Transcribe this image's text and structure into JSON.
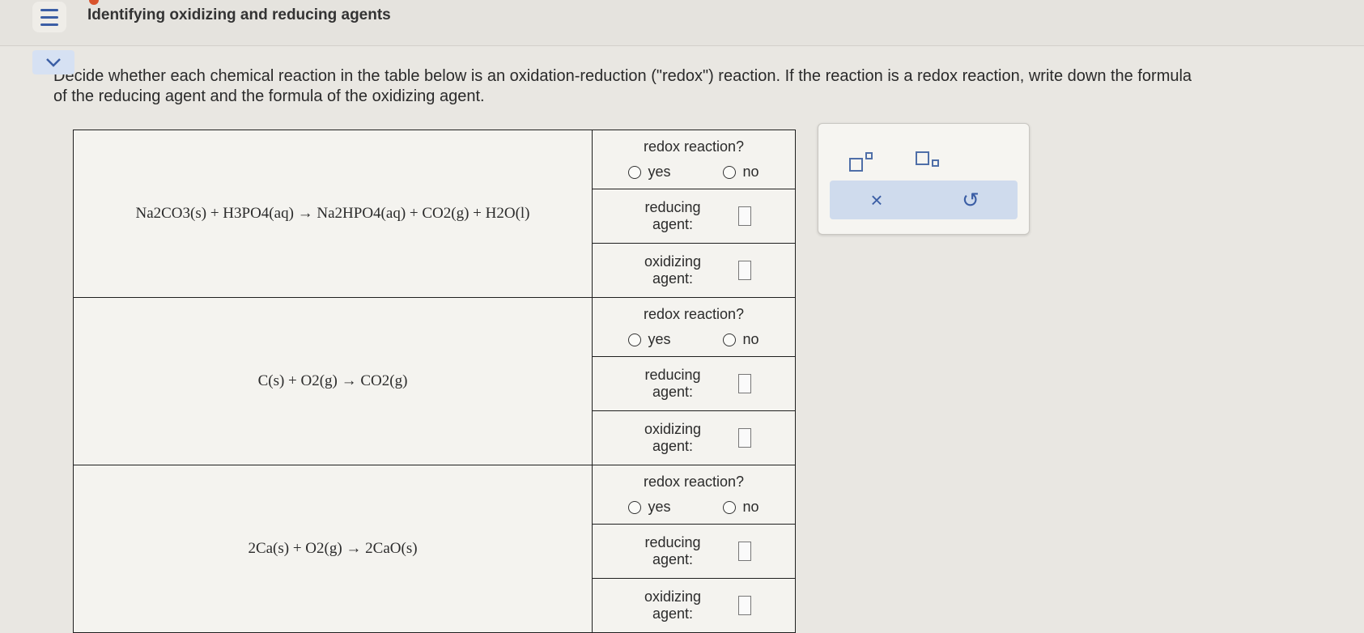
{
  "header": {
    "title": "Identifying oxidizing and reducing agents"
  },
  "instructions": {
    "line1": "Decide whether each chemical reaction in the table below is an oxidation-reduction (\"redox\") reaction. If the reaction is a redox reaction, write down the formula",
    "line2": "of the reducing agent and the formula of the oxidizing agent."
  },
  "labels": {
    "redox_question": "redox reaction?",
    "yes": "yes",
    "no": "no",
    "reducing_agent": "reducing agent:",
    "oxidizing_agent": "oxidizing agent:"
  },
  "reactions": [
    {
      "equation": "Na2CO3(s) + H3PO4(aq) → Na2HPO4(aq) + CO2(g) + H2O(l)"
    },
    {
      "equation": "C(s) + O2(g) → CO2(g)"
    },
    {
      "equation": "2Ca(s) + O2(g) → 2CaO(s)"
    }
  ],
  "palette": {
    "clear_symbol": "×",
    "undo_symbol": "↺"
  },
  "colors": {
    "accent": "#3b5ea5",
    "panel": "#cfdbed"
  }
}
